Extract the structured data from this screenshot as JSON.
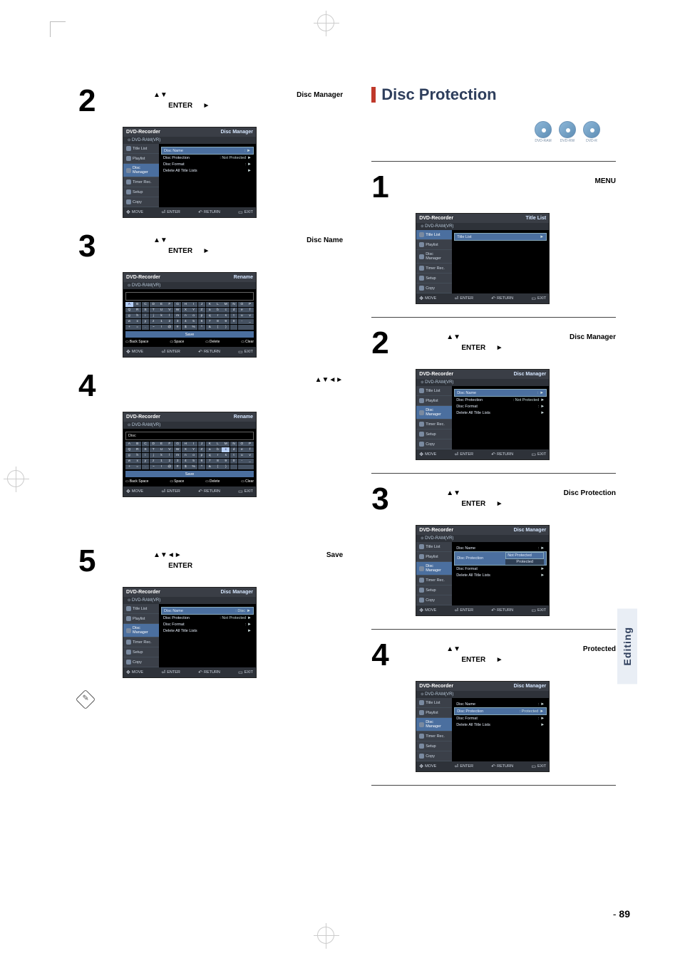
{
  "page": {
    "num": "89",
    "sideTab": "Editing"
  },
  "left": {
    "steps": {
      "s2": {
        "num": "2",
        "sym": "▲▼",
        "mid": "ENTER",
        "arrow": "►",
        "pick": "Disc Manager"
      },
      "s3": {
        "num": "3",
        "sym": "▲▼",
        "mid": "ENTER",
        "arrow": "►",
        "pick": "Disc Name"
      },
      "s4": {
        "num": "4",
        "sym": "▲▼◄►"
      },
      "s5": {
        "num": "5",
        "sym": "▲▼◄►",
        "mid": "ENTER",
        "pick": "Save"
      }
    },
    "osd": {
      "title": "DVD-Recorder",
      "sub": "DVD-RAM(VR)",
      "corner_dm": "Disc Manager",
      "corner_rn": "Rename",
      "side": {
        "titleList": "Title List",
        "playlist": "Playlist",
        "discManager": "Disc Manager",
        "timerRec": "Timer Rec.",
        "setup": "Setup",
        "copy": "Copy"
      },
      "dm": {
        "discName": "Disc Name",
        "discNameVal": ":",
        "discNameVal2": ": Disc",
        "discProt": "Disc Protection",
        "discProtVal": ": Not Protected",
        "discFmt": "Disc Format",
        "discFmtVal": ":",
        "delAll": "Delete All Title Lists"
      },
      "rename": {
        "titleField": "Disc",
        "save": "Save",
        "actions": {
          "back": "Back Space",
          "space": "Space",
          "del": "Delete",
          "clear": "Clear"
        }
      },
      "ftr": {
        "move": "MOVE",
        "enter": "ENTER",
        "ret": "RETURN",
        "exit": "EXIT"
      }
    },
    "notes": {
      "a": "",
      "b": ""
    }
  },
  "right": {
    "heading": "Disc Protection",
    "badges": {
      "a": "DVD-RAM",
      "b": "DVD-RW",
      "c": "DVD-R"
    },
    "steps": {
      "s1": {
        "num": "1",
        "pick": "MENU"
      },
      "s2": {
        "num": "2",
        "sym": "▲▼",
        "mid": "ENTER",
        "arrow": "►",
        "pick": "Disc Manager"
      },
      "s3": {
        "num": "3",
        "sym": "▲▼",
        "mid": "ENTER",
        "arrow": "►",
        "pick": "Disc Protection"
      },
      "s4": {
        "num": "4",
        "sym": "▲▼",
        "mid": "ENTER",
        "arrow": "►",
        "pick": "Protected"
      }
    },
    "osd": {
      "title": "DVD-Recorder",
      "sub": "DVD-RAM(VR)",
      "corner_tl": "Title List",
      "corner_dm": "Disc Manager",
      "side": {
        "titleList": "Title List",
        "playlist": "Playlist",
        "discManager": "Disc Manager",
        "timerRec": "Timer Rec.",
        "setup": "Setup",
        "copy": "Copy"
      },
      "tl": {
        "titleList": "Title List"
      },
      "dm": {
        "discName": "Disc Name",
        "discNameVal": ":",
        "discProt": "Disc Protection",
        "discProtVal": ": Not Protected",
        "discProtValP": ": Protected",
        "discFmt": "Disc Format",
        "discFmtVal": ":",
        "delAll": "Delete All Title Lists",
        "notProtOpt": "Not Protected",
        "protOpt": "Protected"
      },
      "ftr": {
        "move": "MOVE",
        "enter": "ENTER",
        "ret": "RETURN",
        "exit": "EXIT"
      }
    }
  }
}
